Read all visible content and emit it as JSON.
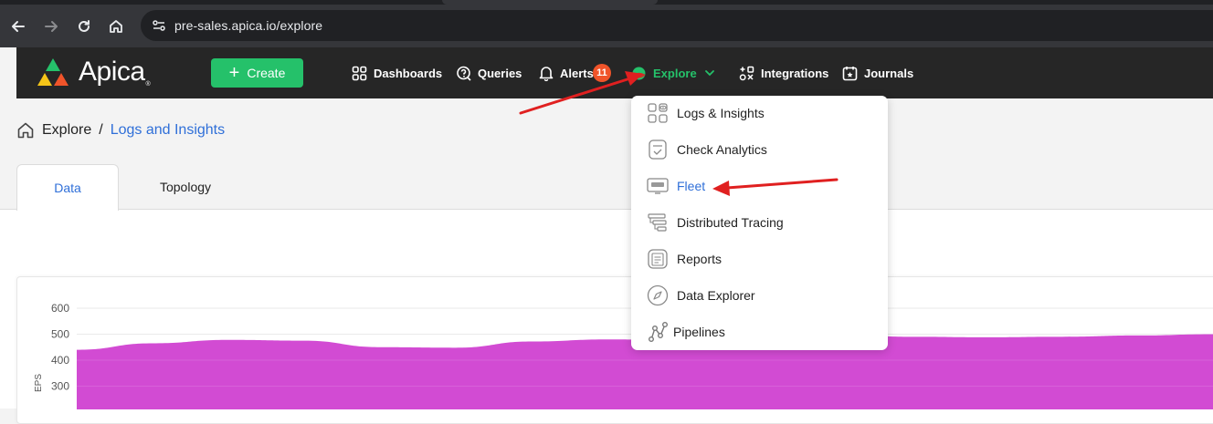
{
  "browser": {
    "url": "pre-sales.apica.io/explore"
  },
  "app": {
    "logo_text": "Apica",
    "create_label": "Create",
    "nav": [
      {
        "label": "Dashboards",
        "icon": "dashboards-grid-icon"
      },
      {
        "label": "Queries",
        "icon": "queries-icon"
      },
      {
        "label": "Alerts",
        "icon": "bell-icon",
        "badge": "11"
      },
      {
        "label": "Explore",
        "icon": "explore-globe-icon",
        "active": true
      },
      {
        "label": "Integrations",
        "icon": "integrations-icon"
      },
      {
        "label": "Journals",
        "icon": "journals-icon"
      }
    ],
    "colors": {
      "accent": "#25c16a",
      "link": "#2f6fd8",
      "badge": "#f0542a",
      "chart_fill": "#d24bd3",
      "annotation_arrow": "#e02020"
    }
  },
  "breadcrumb": {
    "root": "Explore",
    "separator": "/",
    "current": "Logs and Insights"
  },
  "tabs": [
    {
      "label": "Data",
      "active": true
    },
    {
      "label": "Topology",
      "active": false
    }
  ],
  "explore_menu": [
    {
      "label": "Logs & Insights",
      "icon": "logs-insights-icon"
    },
    {
      "label": "Check Analytics",
      "icon": "check-analytics-icon"
    },
    {
      "label": "Fleet",
      "icon": "fleet-icon",
      "highlighted": true
    },
    {
      "label": "Distributed Tracing",
      "icon": "distributed-tracing-icon"
    },
    {
      "label": "Reports",
      "icon": "reports-icon"
    },
    {
      "label": "Data Explorer",
      "icon": "compass-icon"
    },
    {
      "label": "Pipelines",
      "icon": "pipelines-icon"
    }
  ],
  "chart_data": {
    "type": "area",
    "ylabel": "EPS",
    "yticks": [
      "600",
      "500",
      "400",
      "300"
    ],
    "ylim": [
      300,
      600
    ],
    "grid": true,
    "x": [
      0,
      1,
      2,
      3,
      4,
      5,
      6,
      7,
      8,
      9,
      10,
      11,
      12,
      13,
      14,
      15
    ],
    "values": [
      440,
      465,
      478,
      475,
      450,
      448,
      472,
      480,
      478,
      505,
      500,
      490,
      488,
      490,
      495,
      500
    ],
    "series": [
      {
        "values": [
          440,
          465,
          478,
          475,
          450,
          448,
          472,
          480,
          478,
          505,
          500,
          490,
          488,
          490,
          495,
          500
        ]
      }
    ]
  }
}
